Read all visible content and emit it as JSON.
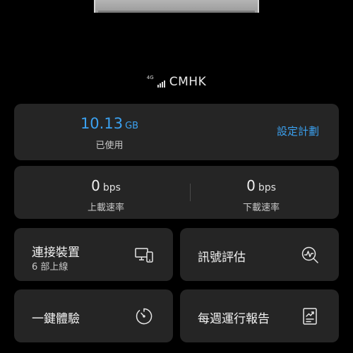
{
  "network": {
    "type": "4G",
    "carrier": "CMHK",
    "signal_bars": 4
  },
  "usage": {
    "value": "10.13",
    "unit": "GB",
    "label": "已使用",
    "set_plan_label": "設定計劃"
  },
  "speed": {
    "upload": {
      "value": "0",
      "unit": "bps",
      "label": "上載速率"
    },
    "download": {
      "value": "0",
      "unit": "bps",
      "label": "下載速率"
    }
  },
  "tiles": {
    "devices": {
      "title": "連接裝置",
      "subtitle": "6 部上線",
      "icon": "devices-icon"
    },
    "signal": {
      "title": "訊號評估",
      "icon": "signal-assessment-icon"
    },
    "test": {
      "title": "一鍵體驗",
      "icon": "timer-icon"
    },
    "report": {
      "title": "每週運行報告",
      "icon": "report-icon"
    }
  },
  "colors": {
    "background": "#000000",
    "card": "#252525",
    "accent": "#3ba1f0"
  }
}
